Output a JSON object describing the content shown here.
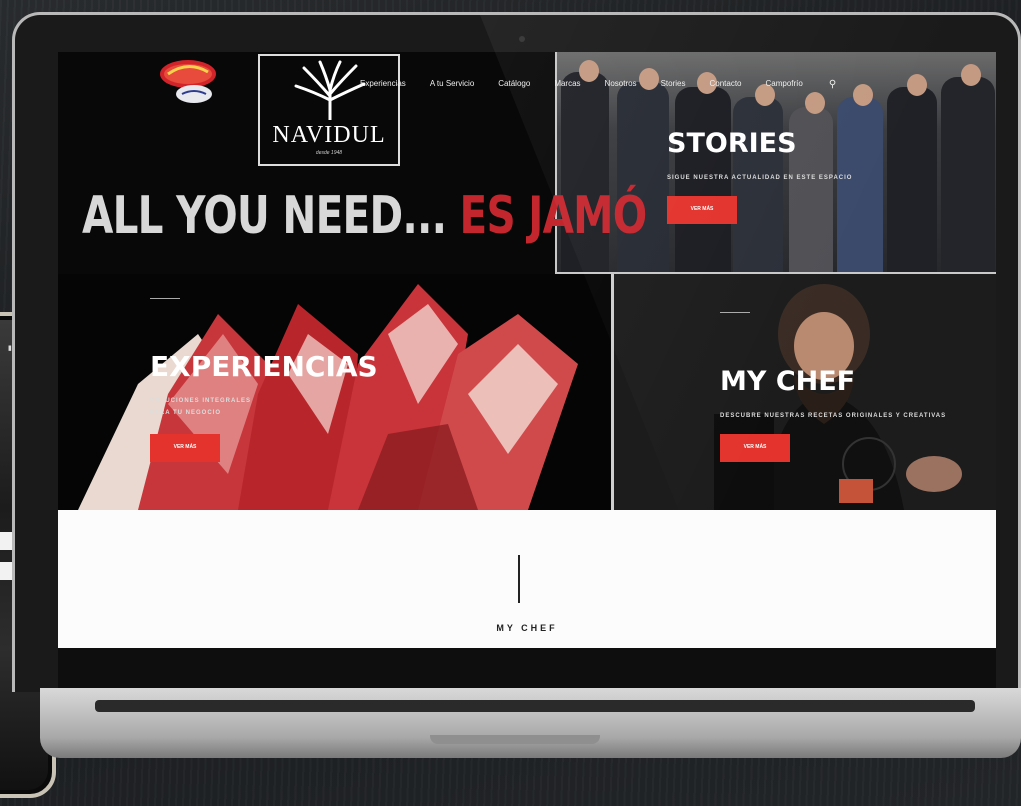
{
  "nav": {
    "items": [
      "Experiencias",
      "A tu Servicio",
      "Catálogo",
      "Marcas",
      "Nosotros",
      "Stories",
      "Contacto",
      "Campofrío"
    ],
    "search_icon": "search-icon"
  },
  "brand": {
    "name": "NAVIDUL",
    "since": "desde 1948",
    "partner_logo": "Campofrío Sabor Intenso"
  },
  "hero": {
    "headline_white": "ALL YOU NEED... ",
    "headline_red": "ES JAMÓ"
  },
  "stories": {
    "title": "STORIES",
    "subtitle": "SIGUE NUESTRA ACTUALIDAD EN ESTE ESPACIO",
    "button": "VER MÁS"
  },
  "experiencias": {
    "title": "EXPERIENCIAS",
    "subtitle_1": "SOLUCIONES INTEGRALES",
    "subtitle_2": "PARA TU NEGOCIO",
    "button": "VER MÁS"
  },
  "mychef": {
    "title": "MY CHEF",
    "subtitle": "DESCUBRE NUESTRAS RECETAS ORIGINALES Y CREATIVAS",
    "button": "VER MÁS"
  },
  "bottom": {
    "section_label": "MY CHEF"
  },
  "colors": {
    "accent_red": "#c4262e",
    "button_red": "#e4332d",
    "dark_bg": "#050505"
  }
}
